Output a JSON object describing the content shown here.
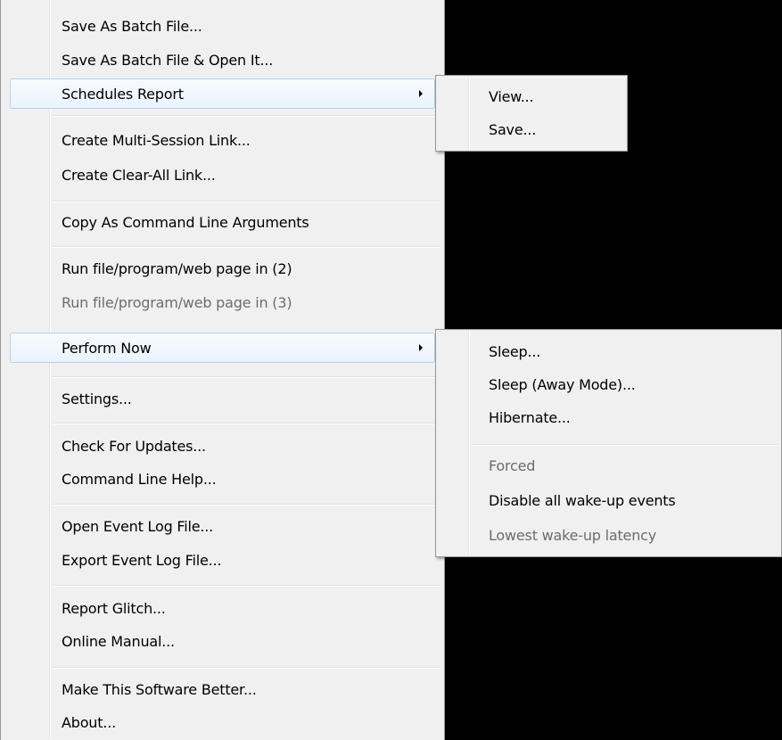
{
  "main_menu": {
    "items": [
      {
        "label": "Save As Batch File..."
      },
      {
        "label": "Save As Batch File & Open It..."
      },
      {
        "label": "Schedules Report"
      },
      {
        "label": "Create Multi-Session Link..."
      },
      {
        "label": "Create Clear-All Link..."
      },
      {
        "label": "Copy As Command Line Arguments"
      },
      {
        "label": "Run file/program/web page in (2)"
      },
      {
        "label": "Run file/program/web page in (3)"
      },
      {
        "label": "Perform Now"
      },
      {
        "label": "Settings..."
      },
      {
        "label": "Check For Updates..."
      },
      {
        "label": "Command Line Help..."
      },
      {
        "label": "Open Event Log File..."
      },
      {
        "label": "Export Event Log File..."
      },
      {
        "label": "Report Glitch..."
      },
      {
        "label": "Online Manual..."
      },
      {
        "label": "Make This Software Better..."
      },
      {
        "label": "About..."
      }
    ]
  },
  "schedules_submenu": {
    "items": [
      {
        "label": "View..."
      },
      {
        "label": "Save..."
      }
    ]
  },
  "perform_submenu": {
    "items": [
      {
        "label": "Sleep..."
      },
      {
        "label": "Sleep (Away Mode)..."
      },
      {
        "label": "Hibernate..."
      },
      {
        "label": "Forced"
      },
      {
        "label": "Disable all wake-up events"
      },
      {
        "label": "Lowest wake-up latency"
      }
    ]
  },
  "colors": {
    "menu_background": "#f0f0f0",
    "highlight_border": "#aed1f5",
    "disabled_text": "#6d6d6d",
    "backdrop": "#000000"
  }
}
